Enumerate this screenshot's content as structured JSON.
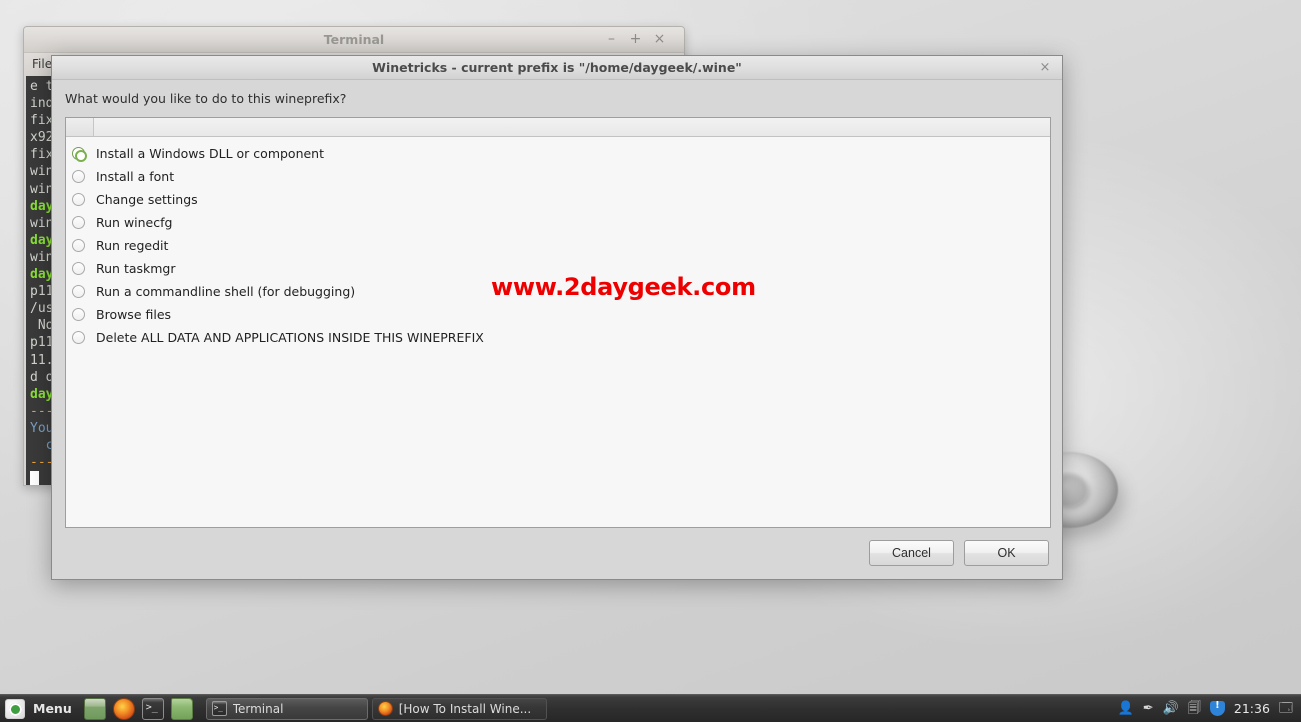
{
  "terminal_window": {
    "title": "Terminal",
    "min_label": "–",
    "max_label": "+",
    "close_label": "×",
    "menu": {
      "file": "File"
    },
    "lines": [
      {
        "text": "e t",
        "color": "w"
      },
      {
        "text": "ind",
        "color": "w"
      },
      {
        "text": "fix",
        "color": "w"
      },
      {
        "text": "x92",
        "color": "w"
      },
      {
        "text": "fix",
        "color": "w"
      },
      {
        "text": "win",
        "color": "w"
      },
      {
        "text": "win",
        "color": "w"
      },
      {
        "text": "day",
        "color": "g"
      },
      {
        "text": "win",
        "color": "w"
      },
      {
        "text": "day",
        "color": "g"
      },
      {
        "text": "win",
        "color": "w"
      },
      {
        "text": "day",
        "color": "g"
      },
      {
        "text": "p11",
        "color": "w"
      },
      {
        "text": "/us",
        "color": "w"
      },
      {
        "text": " No",
        "color": "w"
      },
      {
        "text": "p11",
        "color": "w"
      },
      {
        "text": "11.",
        "color": "w"
      },
      {
        "text": "d o",
        "color": "w"
      },
      {
        "text": "day",
        "color": "g"
      },
      {
        "text": "---",
        "color": "y"
      },
      {
        "text": "You",
        "color": "b"
      },
      {
        "text": "  cl",
        "color": "b"
      },
      {
        "text": "---",
        "color": "y"
      }
    ]
  },
  "dialog": {
    "title": "Winetricks - current prefix is \"/home/daygeek/.wine\"",
    "close_label": "×",
    "prompt": "What would you like to do to this wineprefix?",
    "columns": [
      "",
      ""
    ],
    "options": [
      {
        "label": "Install a Windows DLL or component",
        "selected": true
      },
      {
        "label": "Install a font",
        "selected": false
      },
      {
        "label": "Change settings",
        "selected": false
      },
      {
        "label": "Run winecfg",
        "selected": false
      },
      {
        "label": "Run regedit",
        "selected": false
      },
      {
        "label": "Run taskmgr",
        "selected": false
      },
      {
        "label": "Run a commandline shell (for debugging)",
        "selected": false
      },
      {
        "label": "Browse files",
        "selected": false
      },
      {
        "label": "Delete ALL DATA AND APPLICATIONS INSIDE THIS WINEPREFIX",
        "selected": false
      }
    ],
    "cancel_label": "Cancel",
    "ok_label": "OK"
  },
  "watermark": {
    "text": "www.2daygeek.com",
    "color": "#ee0000"
  },
  "taskbar": {
    "menu_label": "Menu",
    "launchers": [
      {
        "name": "show-desktop"
      },
      {
        "name": "firefox"
      },
      {
        "name": "terminal"
      },
      {
        "name": "file-manager"
      }
    ],
    "windows": [
      {
        "label": "Terminal",
        "active": true,
        "icon": "terminal-icon"
      },
      {
        "label": "[How To Install Wine...",
        "active": false,
        "icon": "firefox-icon"
      }
    ],
    "tray": {
      "user": "👤",
      "pencil": "✒",
      "volume": "🔊",
      "updates": "🗐",
      "shield": "shield-icon",
      "clock": "21:36",
      "workspaces": "🗔"
    }
  }
}
